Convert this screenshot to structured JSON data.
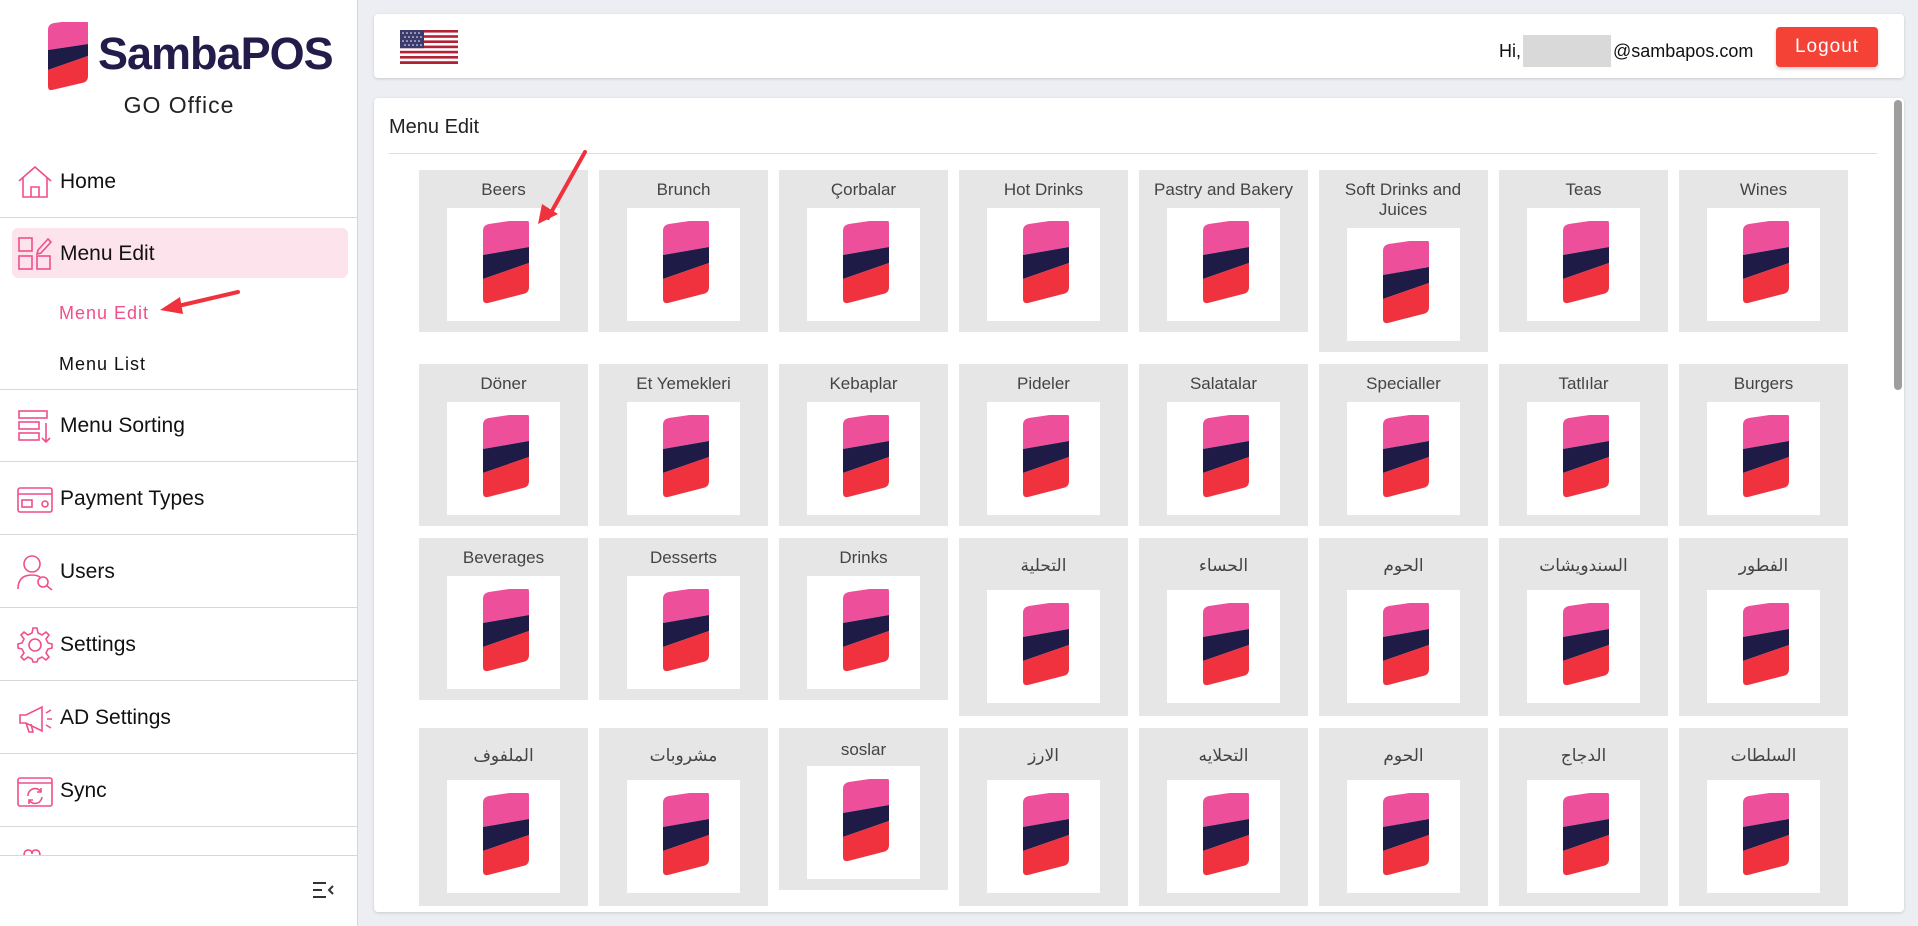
{
  "brand": {
    "name_part1": "Samba",
    "name_part2": "POS",
    "subtitle": "GO Office"
  },
  "sidebar": {
    "items": [
      {
        "id": "home",
        "label": "Home",
        "icon": "home-icon"
      },
      {
        "id": "menu-edit",
        "label": "Menu Edit",
        "icon": "edit-grid-icon",
        "active": true,
        "children": [
          {
            "label": "Menu Edit",
            "active": true
          },
          {
            "label": "Menu List"
          }
        ]
      },
      {
        "id": "menu-sorting",
        "label": "Menu Sorting",
        "icon": "sort-icon"
      },
      {
        "id": "payment-types",
        "label": "Payment Types",
        "icon": "payment-icon"
      },
      {
        "id": "users",
        "label": "Users",
        "icon": "user-icon"
      },
      {
        "id": "settings",
        "label": "Settings",
        "icon": "gear-icon"
      },
      {
        "id": "ad-settings",
        "label": "AD Settings",
        "icon": "megaphone-icon"
      },
      {
        "id": "sync",
        "label": "Sync",
        "icon": "sync-icon"
      }
    ]
  },
  "header": {
    "language_flag": "us-flag-icon",
    "greeting_prefix": "Hi,",
    "greeting_suffix": "@sambapos.com",
    "logout_label": "Logout"
  },
  "main": {
    "title": "Menu Edit",
    "tiles": [
      "Beers",
      "Brunch",
      "Çorbalar",
      "Hot Drinks",
      "Pastry and Bakery",
      "Soft Drinks and Juices",
      "Teas",
      "Wines",
      "Döner",
      "Et Yemekleri",
      "Kebaplar",
      "Pideler",
      "Salatalar",
      "Specialler",
      "Tatlılar",
      "Burgers",
      "Beverages",
      "Desserts",
      "Drinks",
      "التحلية",
      "الحساء",
      "الحوم",
      "السندويشات",
      "الفطور",
      "الملفوف",
      "مشروبات",
      "soslar",
      "الارز",
      "التحلايه",
      "الحوم",
      "الدجاج",
      "السلطات"
    ]
  },
  "colors": {
    "accent": "#ef4f8b",
    "logout": "#f44336",
    "highlight": "#fde4ec",
    "tile_bg": "#e6e6e6",
    "logo_pink": "#ee4f9a",
    "logo_navy": "#1e1b47",
    "logo_red": "#f0323f"
  }
}
